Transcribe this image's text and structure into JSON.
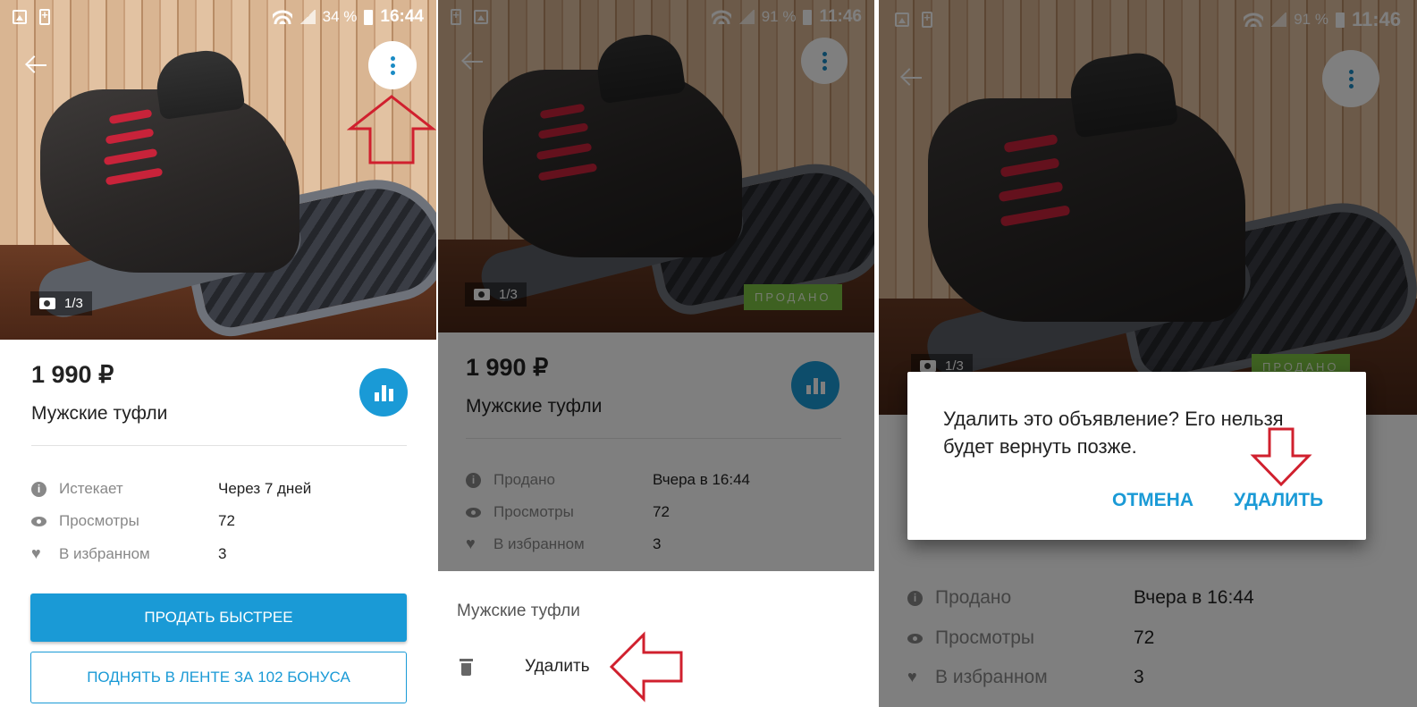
{
  "status_bars": [
    {
      "battery_percent": "34 %",
      "time": "16:44"
    },
    {
      "battery_percent": "91 %",
      "time": "11:46"
    },
    {
      "battery_percent": "91 %",
      "time": "11:46"
    }
  ],
  "listing": {
    "price": "1 990 ₽",
    "title": "Мужские туфли",
    "photo_counter": "1/3",
    "sold_badge": "ПРОДАНО"
  },
  "panel1_info": [
    {
      "icon": "info-icon",
      "label": "Истекает",
      "value": "Через 7 дней"
    },
    {
      "icon": "eye-icon",
      "label": "Просмотры",
      "value": "72"
    },
    {
      "icon": "heart-icon",
      "label": "В избранном",
      "value": "3"
    }
  ],
  "panel2_info": [
    {
      "icon": "info-icon",
      "label": "Продано",
      "value": "Вчера в 16:44"
    },
    {
      "icon": "eye-icon",
      "label": "Просмотры",
      "value": "72"
    },
    {
      "icon": "heart-icon",
      "label": "В избранном",
      "value": "3"
    }
  ],
  "buttons": {
    "sell_faster": "ПРОДАТЬ БЫСТРЕЕ",
    "raise_in_feed": "ПОДНЯТЬ В ЛЕНТЕ ЗА 102 БОНУСА"
  },
  "bottom_sheet": {
    "title": "Мужские туфли",
    "delete_label": "Удалить"
  },
  "dialog": {
    "message": "Удалить это объявление? Его нельзя будет вернуть позже.",
    "cancel": "ОТМЕНА",
    "confirm": "УДАЛИТЬ"
  },
  "colors": {
    "accent": "#1a9ad6",
    "sold_badge": "#7cc243",
    "annotation_arrow": "#d0202e"
  }
}
